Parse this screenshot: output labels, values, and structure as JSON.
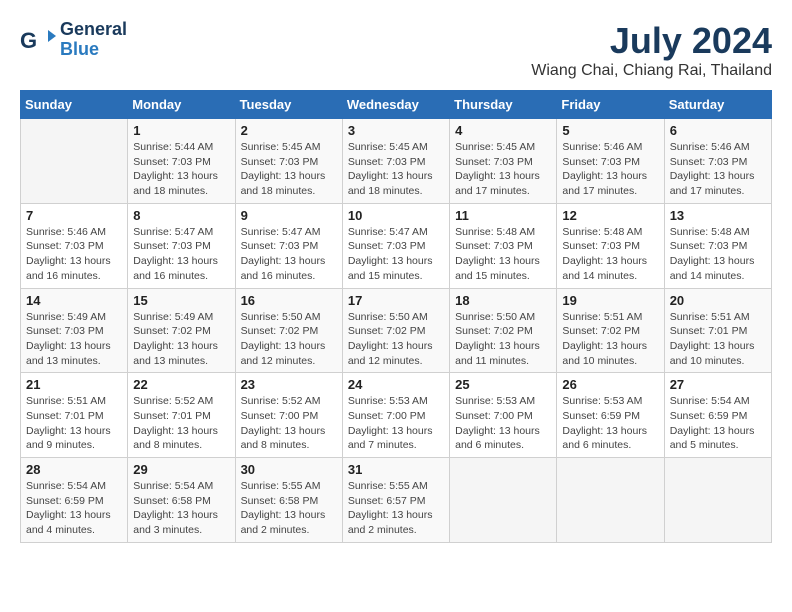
{
  "header": {
    "logo_line1": "General",
    "logo_line2": "Blue",
    "month": "July 2024",
    "location": "Wiang Chai, Chiang Rai, Thailand"
  },
  "weekdays": [
    "Sunday",
    "Monday",
    "Tuesday",
    "Wednesday",
    "Thursday",
    "Friday",
    "Saturday"
  ],
  "weeks": [
    [
      {
        "day": "",
        "info": ""
      },
      {
        "day": "1",
        "info": "Sunrise: 5:44 AM\nSunset: 7:03 PM\nDaylight: 13 hours\nand 18 minutes."
      },
      {
        "day": "2",
        "info": "Sunrise: 5:45 AM\nSunset: 7:03 PM\nDaylight: 13 hours\nand 18 minutes."
      },
      {
        "day": "3",
        "info": "Sunrise: 5:45 AM\nSunset: 7:03 PM\nDaylight: 13 hours\nand 18 minutes."
      },
      {
        "day": "4",
        "info": "Sunrise: 5:45 AM\nSunset: 7:03 PM\nDaylight: 13 hours\nand 17 minutes."
      },
      {
        "day": "5",
        "info": "Sunrise: 5:46 AM\nSunset: 7:03 PM\nDaylight: 13 hours\nand 17 minutes."
      },
      {
        "day": "6",
        "info": "Sunrise: 5:46 AM\nSunset: 7:03 PM\nDaylight: 13 hours\nand 17 minutes."
      }
    ],
    [
      {
        "day": "7",
        "info": "Sunrise: 5:46 AM\nSunset: 7:03 PM\nDaylight: 13 hours\nand 16 minutes."
      },
      {
        "day": "8",
        "info": "Sunrise: 5:47 AM\nSunset: 7:03 PM\nDaylight: 13 hours\nand 16 minutes."
      },
      {
        "day": "9",
        "info": "Sunrise: 5:47 AM\nSunset: 7:03 PM\nDaylight: 13 hours\nand 16 minutes."
      },
      {
        "day": "10",
        "info": "Sunrise: 5:47 AM\nSunset: 7:03 PM\nDaylight: 13 hours\nand 15 minutes."
      },
      {
        "day": "11",
        "info": "Sunrise: 5:48 AM\nSunset: 7:03 PM\nDaylight: 13 hours\nand 15 minutes."
      },
      {
        "day": "12",
        "info": "Sunrise: 5:48 AM\nSunset: 7:03 PM\nDaylight: 13 hours\nand 14 minutes."
      },
      {
        "day": "13",
        "info": "Sunrise: 5:48 AM\nSunset: 7:03 PM\nDaylight: 13 hours\nand 14 minutes."
      }
    ],
    [
      {
        "day": "14",
        "info": "Sunrise: 5:49 AM\nSunset: 7:03 PM\nDaylight: 13 hours\nand 13 minutes."
      },
      {
        "day": "15",
        "info": "Sunrise: 5:49 AM\nSunset: 7:02 PM\nDaylight: 13 hours\nand 13 minutes."
      },
      {
        "day": "16",
        "info": "Sunrise: 5:50 AM\nSunset: 7:02 PM\nDaylight: 13 hours\nand 12 minutes."
      },
      {
        "day": "17",
        "info": "Sunrise: 5:50 AM\nSunset: 7:02 PM\nDaylight: 13 hours\nand 12 minutes."
      },
      {
        "day": "18",
        "info": "Sunrise: 5:50 AM\nSunset: 7:02 PM\nDaylight: 13 hours\nand 11 minutes."
      },
      {
        "day": "19",
        "info": "Sunrise: 5:51 AM\nSunset: 7:02 PM\nDaylight: 13 hours\nand 10 minutes."
      },
      {
        "day": "20",
        "info": "Sunrise: 5:51 AM\nSunset: 7:01 PM\nDaylight: 13 hours\nand 10 minutes."
      }
    ],
    [
      {
        "day": "21",
        "info": "Sunrise: 5:51 AM\nSunset: 7:01 PM\nDaylight: 13 hours\nand 9 minutes."
      },
      {
        "day": "22",
        "info": "Sunrise: 5:52 AM\nSunset: 7:01 PM\nDaylight: 13 hours\nand 8 minutes."
      },
      {
        "day": "23",
        "info": "Sunrise: 5:52 AM\nSunset: 7:00 PM\nDaylight: 13 hours\nand 8 minutes."
      },
      {
        "day": "24",
        "info": "Sunrise: 5:53 AM\nSunset: 7:00 PM\nDaylight: 13 hours\nand 7 minutes."
      },
      {
        "day": "25",
        "info": "Sunrise: 5:53 AM\nSunset: 7:00 PM\nDaylight: 13 hours\nand 6 minutes."
      },
      {
        "day": "26",
        "info": "Sunrise: 5:53 AM\nSunset: 6:59 PM\nDaylight: 13 hours\nand 6 minutes."
      },
      {
        "day": "27",
        "info": "Sunrise: 5:54 AM\nSunset: 6:59 PM\nDaylight: 13 hours\nand 5 minutes."
      }
    ],
    [
      {
        "day": "28",
        "info": "Sunrise: 5:54 AM\nSunset: 6:59 PM\nDaylight: 13 hours\nand 4 minutes."
      },
      {
        "day": "29",
        "info": "Sunrise: 5:54 AM\nSunset: 6:58 PM\nDaylight: 13 hours\nand 3 minutes."
      },
      {
        "day": "30",
        "info": "Sunrise: 5:55 AM\nSunset: 6:58 PM\nDaylight: 13 hours\nand 2 minutes."
      },
      {
        "day": "31",
        "info": "Sunrise: 5:55 AM\nSunset: 6:57 PM\nDaylight: 13 hours\nand 2 minutes."
      },
      {
        "day": "",
        "info": ""
      },
      {
        "day": "",
        "info": ""
      },
      {
        "day": "",
        "info": ""
      }
    ]
  ]
}
